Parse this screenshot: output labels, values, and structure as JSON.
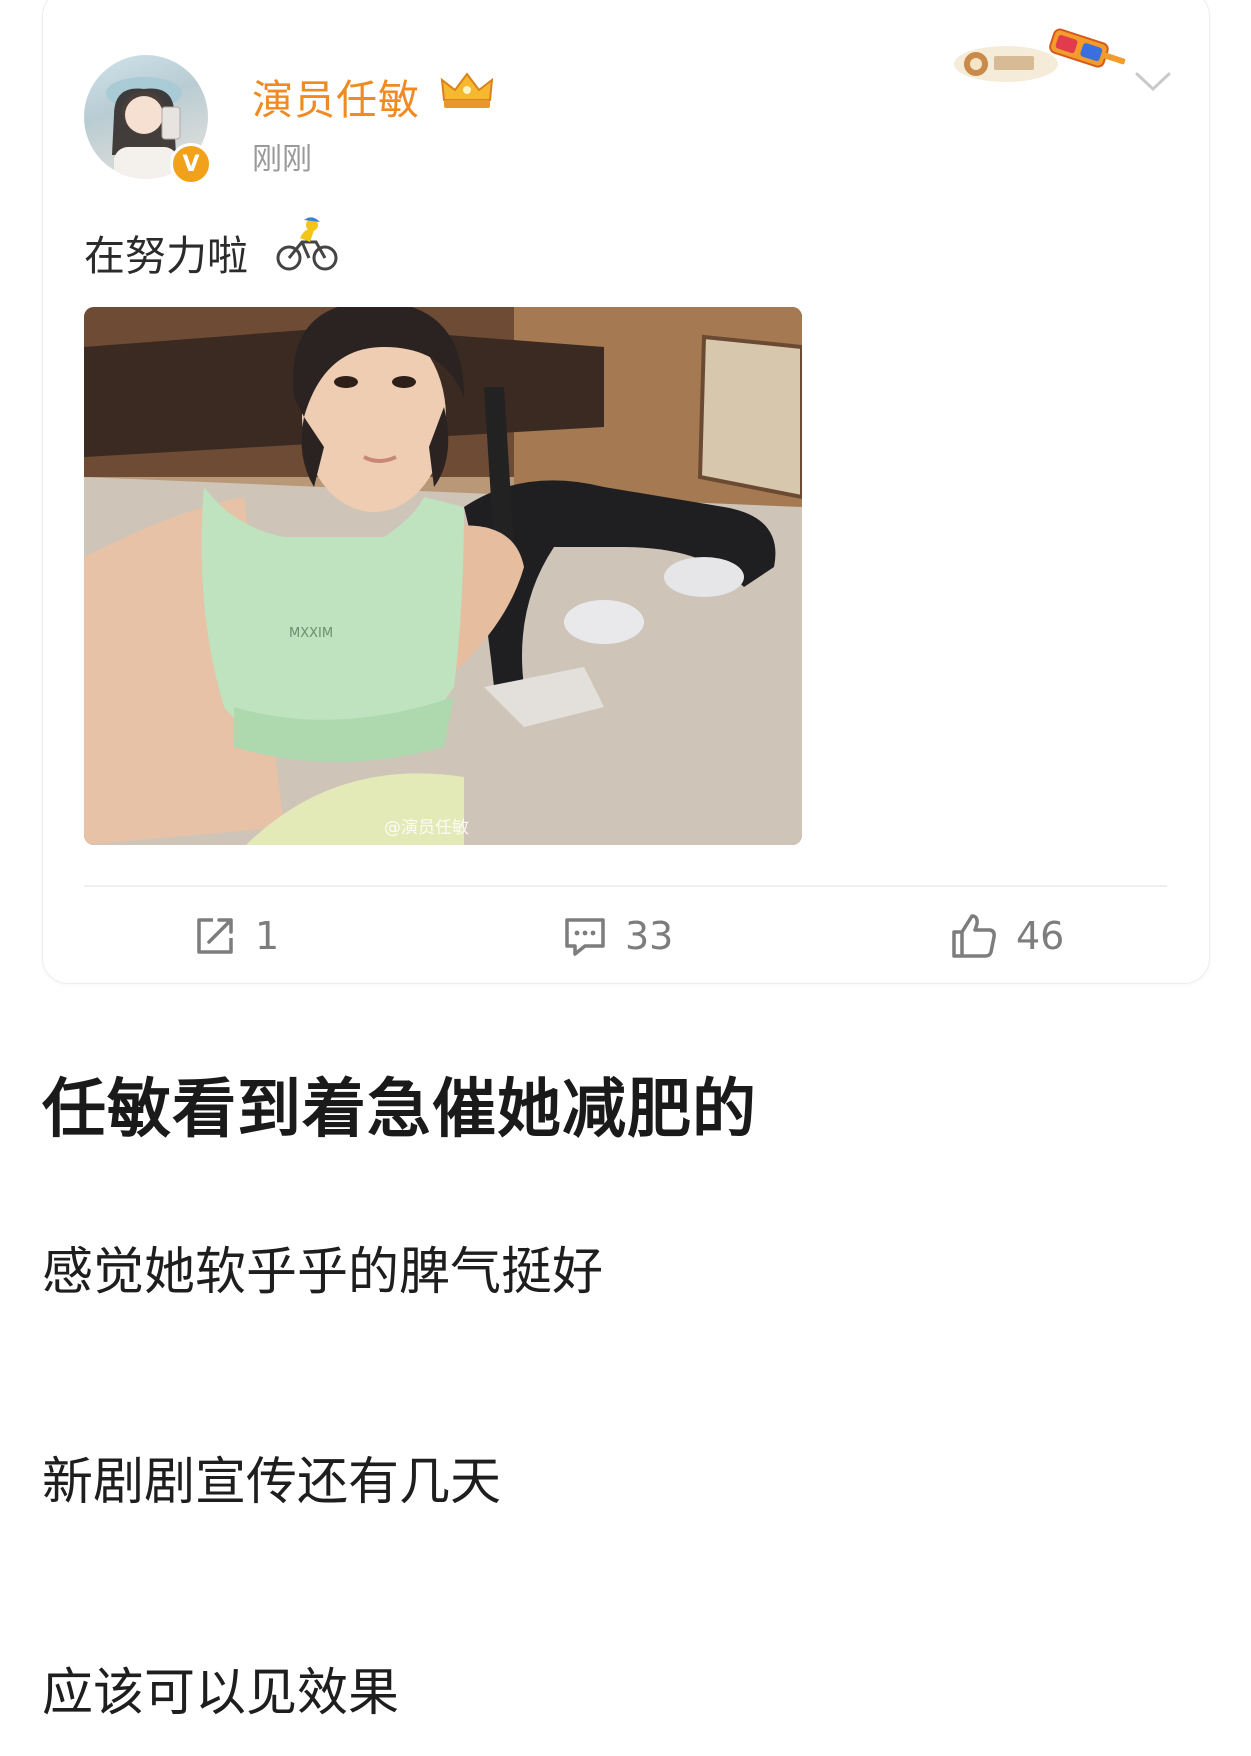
{
  "post": {
    "username": "演员任敏",
    "timestamp": "刚刚",
    "verified_badge": "V",
    "text": "在努力啦",
    "photo_watermark": "@演员任敏",
    "actions": {
      "repost_count": "1",
      "comment_count": "33",
      "like_count": "46"
    }
  },
  "article": {
    "headline": "任敏看到着急催她减肥的",
    "paragraphs": [
      "感觉她软乎乎的脾气挺好",
      "新剧剧宣传还有几天",
      "应该可以见效果"
    ]
  },
  "colors": {
    "username": "#f08a23",
    "verified": "#f2a11b",
    "meta_gray": "#9a9a9a",
    "action_gray": "#7d7d7d"
  },
  "icons": [
    "crown-badge-icon",
    "fan-pendant-icon",
    "chevron-down-icon",
    "cyclist-emoji-icon",
    "repost-icon",
    "comment-icon",
    "like-icon"
  ]
}
